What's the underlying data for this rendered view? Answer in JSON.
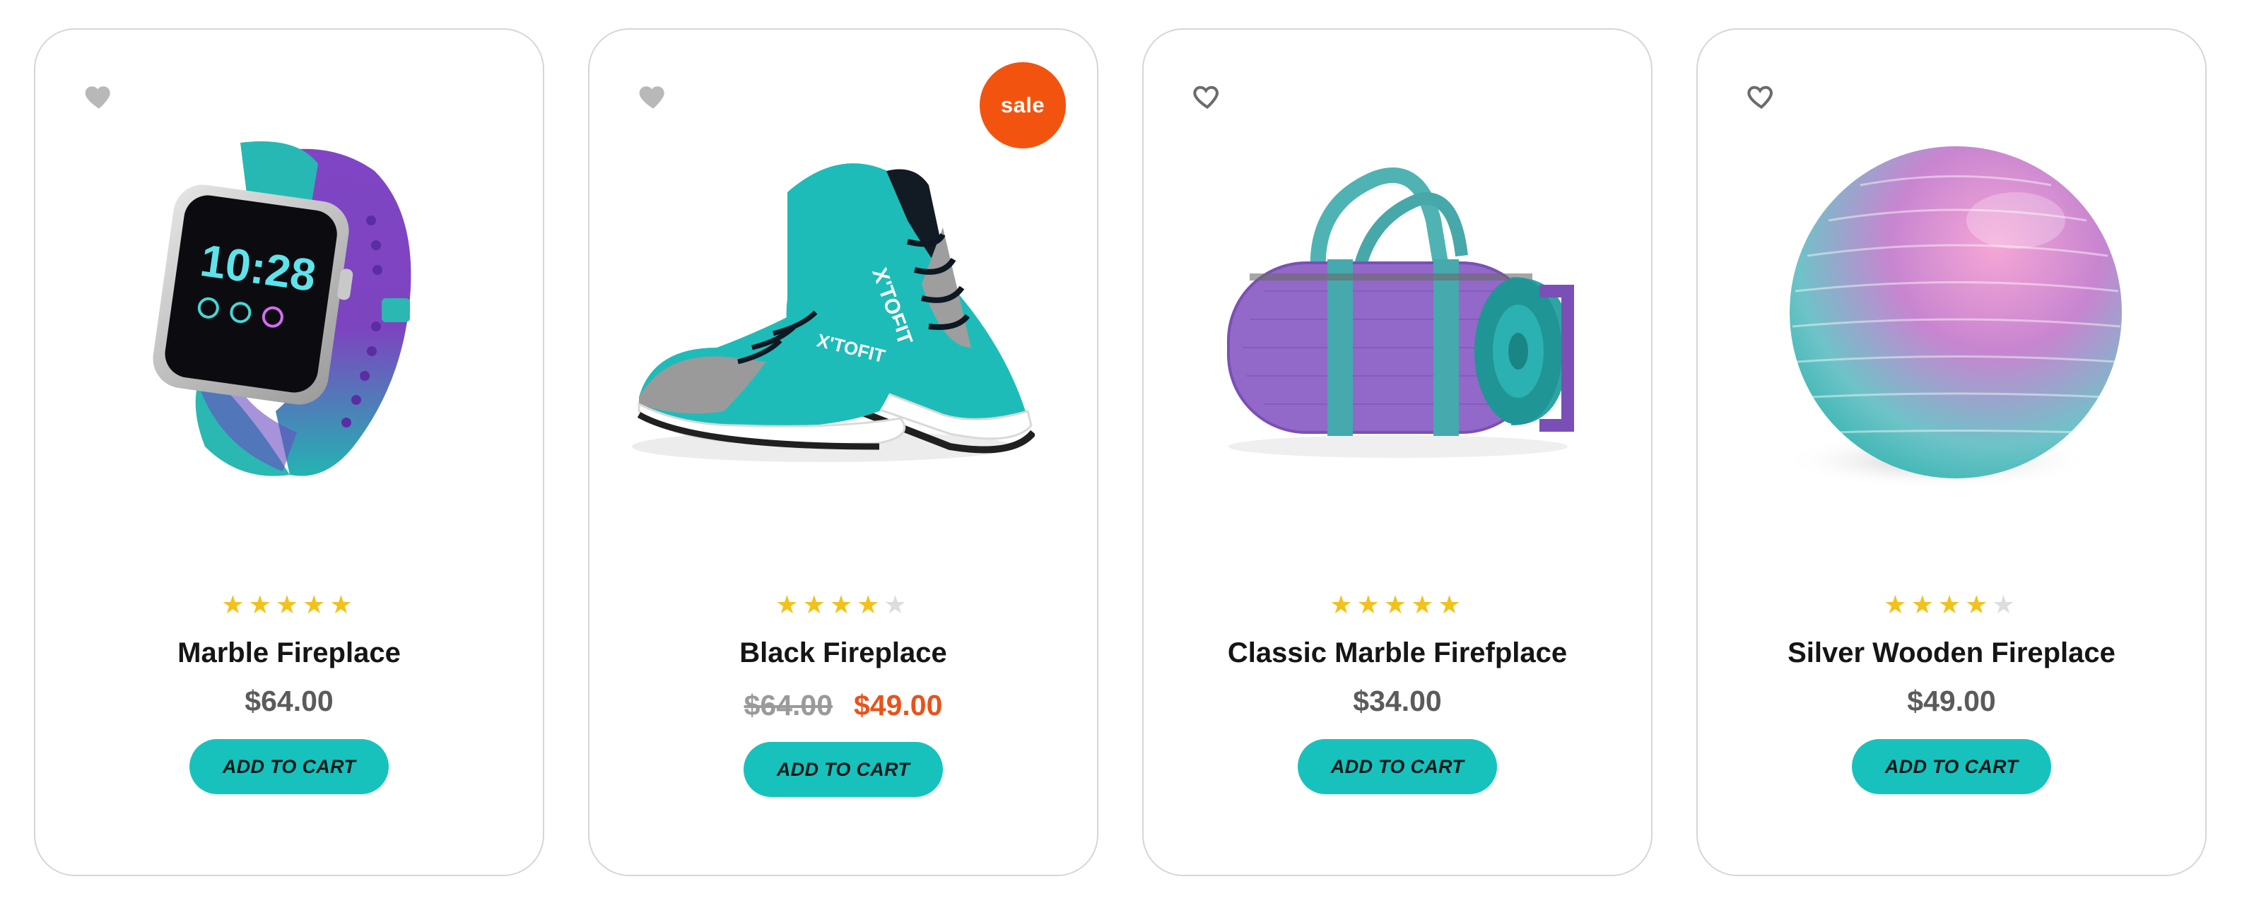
{
  "products": [
    {
      "image": "smartwatch-image",
      "watch_time": "10:28",
      "favorite_icon": "heart-filled-icon",
      "rating": 5,
      "rating_max": 5,
      "name": "Marble Fireplace",
      "price": "$64.00",
      "cart_label": "ADD TO CART"
    },
    {
      "image": "sneakers-image",
      "shoe_brand": "X'TOFIT",
      "favorite_icon": "heart-filled-icon",
      "badge": "sale",
      "rating": 4,
      "rating_max": 5,
      "name": "Black Fireplace",
      "old_price": "$64.00",
      "price": "$49.00",
      "cart_label": "ADD TO CART"
    },
    {
      "image": "gym-bag-image",
      "favorite_icon": "heart-outline-icon",
      "rating": 5,
      "rating_max": 5,
      "name": "Classic Marble Firefplace",
      "price": "$34.00",
      "cart_label": "ADD TO CART"
    },
    {
      "image": "exercise-ball-image",
      "favorite_icon": "heart-outline-icon",
      "rating": 4,
      "rating_max": 5,
      "name": "Silver Wooden Fireplace",
      "price": "$49.00",
      "cart_label": "ADD TO CART"
    }
  ],
  "colors": {
    "accent_teal": "#17c2bd",
    "sale_orange": "#f2540f",
    "star_gold": "#f2c21a",
    "star_empty": "#dddddd",
    "card_border": "#d6d6d6"
  }
}
